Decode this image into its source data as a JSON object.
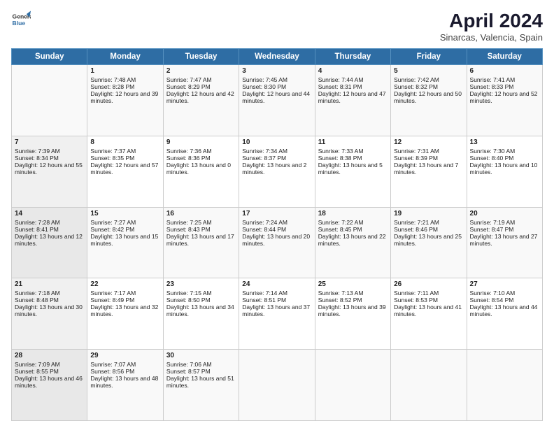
{
  "logo": {
    "line1": "General",
    "line2": "Blue"
  },
  "title": "April 2024",
  "subtitle": "Sinarcas, Valencia, Spain",
  "headers": [
    "Sunday",
    "Monday",
    "Tuesday",
    "Wednesday",
    "Thursday",
    "Friday",
    "Saturday"
  ],
  "weeks": [
    [
      {
        "day": "",
        "sunrise": "",
        "sunset": "",
        "daylight": ""
      },
      {
        "day": "1",
        "sunrise": "Sunrise: 7:48 AM",
        "sunset": "Sunset: 8:28 PM",
        "daylight": "Daylight: 12 hours and 39 minutes."
      },
      {
        "day": "2",
        "sunrise": "Sunrise: 7:47 AM",
        "sunset": "Sunset: 8:29 PM",
        "daylight": "Daylight: 12 hours and 42 minutes."
      },
      {
        "day": "3",
        "sunrise": "Sunrise: 7:45 AM",
        "sunset": "Sunset: 8:30 PM",
        "daylight": "Daylight: 12 hours and 44 minutes."
      },
      {
        "day": "4",
        "sunrise": "Sunrise: 7:44 AM",
        "sunset": "Sunset: 8:31 PM",
        "daylight": "Daylight: 12 hours and 47 minutes."
      },
      {
        "day": "5",
        "sunrise": "Sunrise: 7:42 AM",
        "sunset": "Sunset: 8:32 PM",
        "daylight": "Daylight: 12 hours and 50 minutes."
      },
      {
        "day": "6",
        "sunrise": "Sunrise: 7:41 AM",
        "sunset": "Sunset: 8:33 PM",
        "daylight": "Daylight: 12 hours and 52 minutes."
      }
    ],
    [
      {
        "day": "7",
        "sunrise": "Sunrise: 7:39 AM",
        "sunset": "Sunset: 8:34 PM",
        "daylight": "Daylight: 12 hours and 55 minutes."
      },
      {
        "day": "8",
        "sunrise": "Sunrise: 7:37 AM",
        "sunset": "Sunset: 8:35 PM",
        "daylight": "Daylight: 12 hours and 57 minutes."
      },
      {
        "day": "9",
        "sunrise": "Sunrise: 7:36 AM",
        "sunset": "Sunset: 8:36 PM",
        "daylight": "Daylight: 13 hours and 0 minutes."
      },
      {
        "day": "10",
        "sunrise": "Sunrise: 7:34 AM",
        "sunset": "Sunset: 8:37 PM",
        "daylight": "Daylight: 13 hours and 2 minutes."
      },
      {
        "day": "11",
        "sunrise": "Sunrise: 7:33 AM",
        "sunset": "Sunset: 8:38 PM",
        "daylight": "Daylight: 13 hours and 5 minutes."
      },
      {
        "day": "12",
        "sunrise": "Sunrise: 7:31 AM",
        "sunset": "Sunset: 8:39 PM",
        "daylight": "Daylight: 13 hours and 7 minutes."
      },
      {
        "day": "13",
        "sunrise": "Sunrise: 7:30 AM",
        "sunset": "Sunset: 8:40 PM",
        "daylight": "Daylight: 13 hours and 10 minutes."
      }
    ],
    [
      {
        "day": "14",
        "sunrise": "Sunrise: 7:28 AM",
        "sunset": "Sunset: 8:41 PM",
        "daylight": "Daylight: 13 hours and 12 minutes."
      },
      {
        "day": "15",
        "sunrise": "Sunrise: 7:27 AM",
        "sunset": "Sunset: 8:42 PM",
        "daylight": "Daylight: 13 hours and 15 minutes."
      },
      {
        "day": "16",
        "sunrise": "Sunrise: 7:25 AM",
        "sunset": "Sunset: 8:43 PM",
        "daylight": "Daylight: 13 hours and 17 minutes."
      },
      {
        "day": "17",
        "sunrise": "Sunrise: 7:24 AM",
        "sunset": "Sunset: 8:44 PM",
        "daylight": "Daylight: 13 hours and 20 minutes."
      },
      {
        "day": "18",
        "sunrise": "Sunrise: 7:22 AM",
        "sunset": "Sunset: 8:45 PM",
        "daylight": "Daylight: 13 hours and 22 minutes."
      },
      {
        "day": "19",
        "sunrise": "Sunrise: 7:21 AM",
        "sunset": "Sunset: 8:46 PM",
        "daylight": "Daylight: 13 hours and 25 minutes."
      },
      {
        "day": "20",
        "sunrise": "Sunrise: 7:19 AM",
        "sunset": "Sunset: 8:47 PM",
        "daylight": "Daylight: 13 hours and 27 minutes."
      }
    ],
    [
      {
        "day": "21",
        "sunrise": "Sunrise: 7:18 AM",
        "sunset": "Sunset: 8:48 PM",
        "daylight": "Daylight: 13 hours and 30 minutes."
      },
      {
        "day": "22",
        "sunrise": "Sunrise: 7:17 AM",
        "sunset": "Sunset: 8:49 PM",
        "daylight": "Daylight: 13 hours and 32 minutes."
      },
      {
        "day": "23",
        "sunrise": "Sunrise: 7:15 AM",
        "sunset": "Sunset: 8:50 PM",
        "daylight": "Daylight: 13 hours and 34 minutes."
      },
      {
        "day": "24",
        "sunrise": "Sunrise: 7:14 AM",
        "sunset": "Sunset: 8:51 PM",
        "daylight": "Daylight: 13 hours and 37 minutes."
      },
      {
        "day": "25",
        "sunrise": "Sunrise: 7:13 AM",
        "sunset": "Sunset: 8:52 PM",
        "daylight": "Daylight: 13 hours and 39 minutes."
      },
      {
        "day": "26",
        "sunrise": "Sunrise: 7:11 AM",
        "sunset": "Sunset: 8:53 PM",
        "daylight": "Daylight: 13 hours and 41 minutes."
      },
      {
        "day": "27",
        "sunrise": "Sunrise: 7:10 AM",
        "sunset": "Sunset: 8:54 PM",
        "daylight": "Daylight: 13 hours and 44 minutes."
      }
    ],
    [
      {
        "day": "28",
        "sunrise": "Sunrise: 7:09 AM",
        "sunset": "Sunset: 8:55 PM",
        "daylight": "Daylight: 13 hours and 46 minutes."
      },
      {
        "day": "29",
        "sunrise": "Sunrise: 7:07 AM",
        "sunset": "Sunset: 8:56 PM",
        "daylight": "Daylight: 13 hours and 48 minutes."
      },
      {
        "day": "30",
        "sunrise": "Sunrise: 7:06 AM",
        "sunset": "Sunset: 8:57 PM",
        "daylight": "Daylight: 13 hours and 51 minutes."
      },
      {
        "day": "",
        "sunrise": "",
        "sunset": "",
        "daylight": ""
      },
      {
        "day": "",
        "sunrise": "",
        "sunset": "",
        "daylight": ""
      },
      {
        "day": "",
        "sunrise": "",
        "sunset": "",
        "daylight": ""
      },
      {
        "day": "",
        "sunrise": "",
        "sunset": "",
        "daylight": ""
      }
    ]
  ]
}
